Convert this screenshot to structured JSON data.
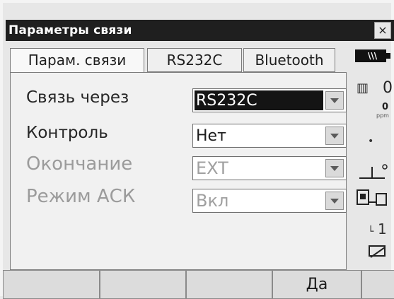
{
  "window": {
    "title": "Параметры связи",
    "close_label": "×"
  },
  "tabs": [
    {
      "label": "Парам. связи",
      "active": true
    },
    {
      "label": "RS232C",
      "active": false
    },
    {
      "label": "Bluetooth",
      "active": false
    }
  ],
  "fields": [
    {
      "label": "Связь через",
      "value": "RS232C",
      "enabled": true,
      "highlighted": true
    },
    {
      "label": "Контроль",
      "value": "Нет",
      "enabled": true,
      "highlighted": false
    },
    {
      "label": "Окончание",
      "value": "EXT",
      "enabled": false,
      "highlighted": false
    },
    {
      "label": "Режим АСК",
      "value": "Вкл",
      "enabled": false,
      "highlighted": false
    }
  ],
  "status": {
    "battery_icon": "battery-icon",
    "value_0": "0",
    "ppm_value": "0",
    "ppm_label": "ppm",
    "mode_number": "1"
  },
  "softkeys": [
    "",
    "",
    "",
    "Да",
    ""
  ]
}
